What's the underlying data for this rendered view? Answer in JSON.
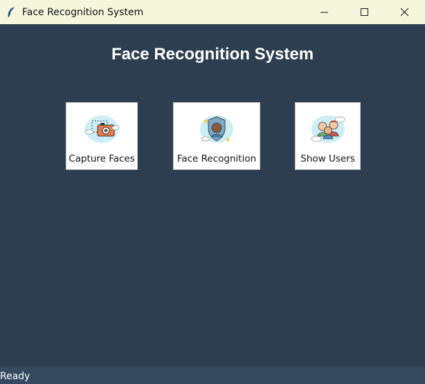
{
  "window": {
    "title": "Face Recognition System",
    "icon": "feather-icon",
    "controls": [
      "minimize-icon",
      "maximize-icon",
      "close-icon"
    ]
  },
  "main": {
    "heading": "Face Recognition System",
    "buttons": [
      {
        "label": "Capture Faces",
        "icon": "camera-capture-icon"
      },
      {
        "label": "Face Recognition",
        "icon": "face-shield-icon"
      },
      {
        "label": "Show Users",
        "icon": "users-icon"
      }
    ]
  },
  "status": {
    "text": "Ready"
  },
  "colors": {
    "background": "#2c3e50",
    "titlebar": "#f4f7dc",
    "statusbar": "#34495e",
    "button_bg": "#ffffff",
    "heading_text": "#ffffff"
  }
}
